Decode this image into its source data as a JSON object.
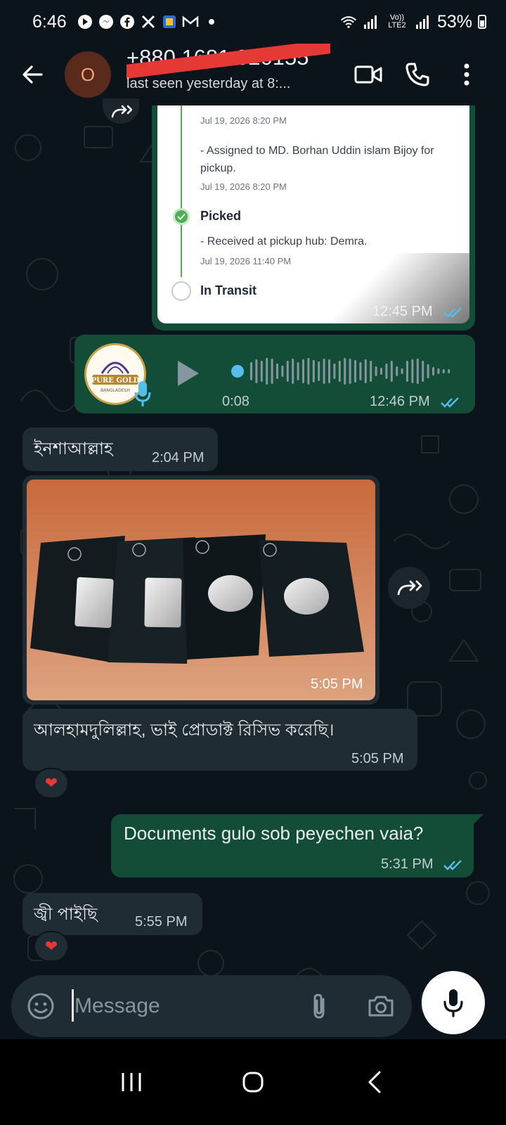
{
  "status_bar": {
    "time": "6:46",
    "lte_label": "Vo)) LTE2",
    "battery": "53%"
  },
  "header": {
    "avatar_letter": "O",
    "contact_name": "+880 1681 020155",
    "last_seen": "last seen yesterday at 8:..."
  },
  "tracking_card": {
    "date_top": "Jul 19, 2026 8:20 PM",
    "assigned_text": "- Assigned to MD. Borhan Uddin islam Bijoy for pickup.",
    "assigned_date": "Jul 19, 2026 8:20 PM",
    "picked_label": "Picked",
    "received_text": "- Received at pickup hub: Demra.",
    "received_date": "Jul 19, 2026 11:40 PM",
    "transit_label": "In Transit",
    "time": "12:45 PM"
  },
  "voice_message": {
    "avatar_line1": "PURE GOLD",
    "avatar_line2": "BANGLADESH",
    "duration": "0:08",
    "time": "12:46 PM"
  },
  "messages": [
    {
      "text": "ইনশাআল্লাহ",
      "time": "2:04 PM"
    },
    {
      "text": "",
      "time": "5:05 PM"
    },
    {
      "text": "আলহামদুলিল্লাহ, ভাই প্রোডাক্ট রিসিভ করেছি।",
      "time": "5:05 PM"
    },
    {
      "text": "Documents gulo sob peyechen vaia?",
      "time": "5:31 PM"
    },
    {
      "text": "জ্বী পাইছি",
      "time": "5:55 PM"
    }
  ],
  "reactions": [
    "❤",
    "❤"
  ],
  "composer": {
    "placeholder": "Message"
  },
  "colors": {
    "background": "#0b141a",
    "outgoing_bubble": "#144d37",
    "incoming_bubble": "#202c33",
    "tick_blue": "#53bdeb",
    "accent_green": "#4caf50"
  }
}
